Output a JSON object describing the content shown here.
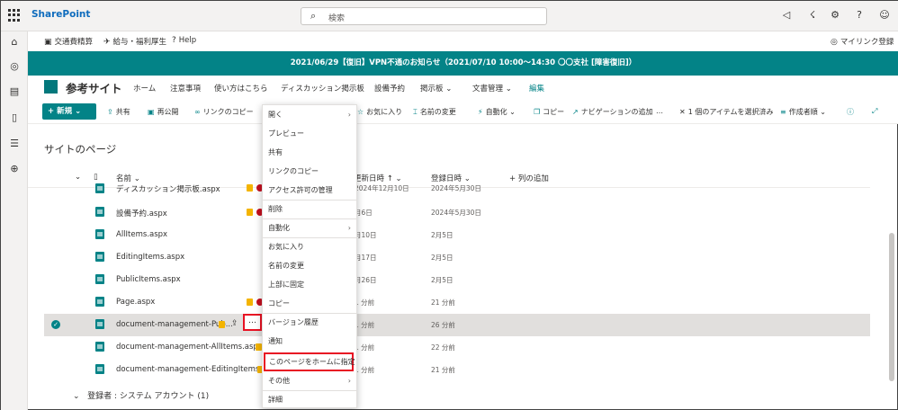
{
  "suite": {
    "app_name": "SharePoint",
    "search_placeholder": "検索"
  },
  "hub": {
    "links": [
      "交通費精算",
      "給与・福利厚生",
      "Help"
    ],
    "my_link": "マイリンク登録"
  },
  "banner": {
    "text": "2021/06/29【復旧】VPN不通のお知らせ（2021/07/10 10:00～14:30 〇〇支社 [障害復旧]）"
  },
  "site": {
    "title": "参考サイト",
    "nav": [
      "ホーム",
      "注意事項",
      "使い方はこちら",
      "ディスカッション掲示板",
      "設備予約",
      "掲示板",
      "文書管理",
      "編集"
    ]
  },
  "commands": {
    "new": "新規",
    "share": "共有",
    "republish": "再公開",
    "copy_link": "リンクのコピー",
    "favorite": "お気に入り",
    "rename": "名前の変更",
    "automate": "自動化",
    "copy": "コピー",
    "add_nav": "ナビゲーションの追加",
    "more": "…",
    "selected": "1 個のアイテムを選択済み",
    "sort": "作成者順"
  },
  "page": {
    "title": "サイトのページ",
    "columns": {
      "name": "名前",
      "modified": "更新日時 ↑",
      "created": "登録日時",
      "add_column": "+ 列の追加"
    },
    "rows": [
      {
        "name": "ディスカッション掲示板.aspx",
        "modified": "2024年12月10日",
        "created": "2024年5月30日"
      },
      {
        "name": "設備予約.aspx",
        "modified": "月6日",
        "created": "2024年5月30日"
      },
      {
        "name": "AllItems.aspx",
        "modified": "月10日",
        "created": "2月5日"
      },
      {
        "name": "EditingItems.aspx",
        "modified": "月17日",
        "created": "2月5日"
      },
      {
        "name": "PublicItems.aspx",
        "modified": "月26日",
        "created": "2月5日"
      },
      {
        "name": "Page.aspx",
        "modified": "1 分前",
        "created": "21 分前"
      },
      {
        "name": "document-management-Pub...",
        "modified": "1 分前",
        "created": "26 分前"
      },
      {
        "name": "document-management-AllItems.aspx",
        "modified": "1 分前",
        "created": "22 分前"
      },
      {
        "name": "document-management-EditingItems.aspx",
        "modified": "1 分前",
        "created": "21 分前"
      }
    ],
    "group_label": "登録者 : システム アカウント (1)",
    "more_button": "…"
  },
  "context_menu": {
    "items": [
      {
        "label": "開く",
        "submenu": true
      },
      {
        "label": "プレビュー",
        "submenu": false
      },
      {
        "label": "共有",
        "submenu": false
      },
      {
        "label": "リンクのコピー",
        "submenu": false
      },
      {
        "label": "アクセス許可の管理",
        "submenu": false
      },
      {
        "label": "削除",
        "submenu": false
      },
      {
        "label": "自動化",
        "submenu": true
      },
      {
        "label": "お気に入り",
        "submenu": false
      },
      {
        "label": "名前の変更",
        "submenu": false
      },
      {
        "label": "上部に固定",
        "submenu": false
      },
      {
        "label": "コピー",
        "submenu": false
      },
      {
        "label": "バージョン履歴",
        "submenu": false
      },
      {
        "label": "通知",
        "submenu": false
      },
      {
        "label": "このページをホームに指定",
        "submenu": false
      },
      {
        "label": "その他",
        "submenu": true
      },
      {
        "label": "詳細",
        "submenu": false
      }
    ]
  },
  "colors": {
    "accent": "#038387",
    "highlight_border": "#e81123"
  }
}
